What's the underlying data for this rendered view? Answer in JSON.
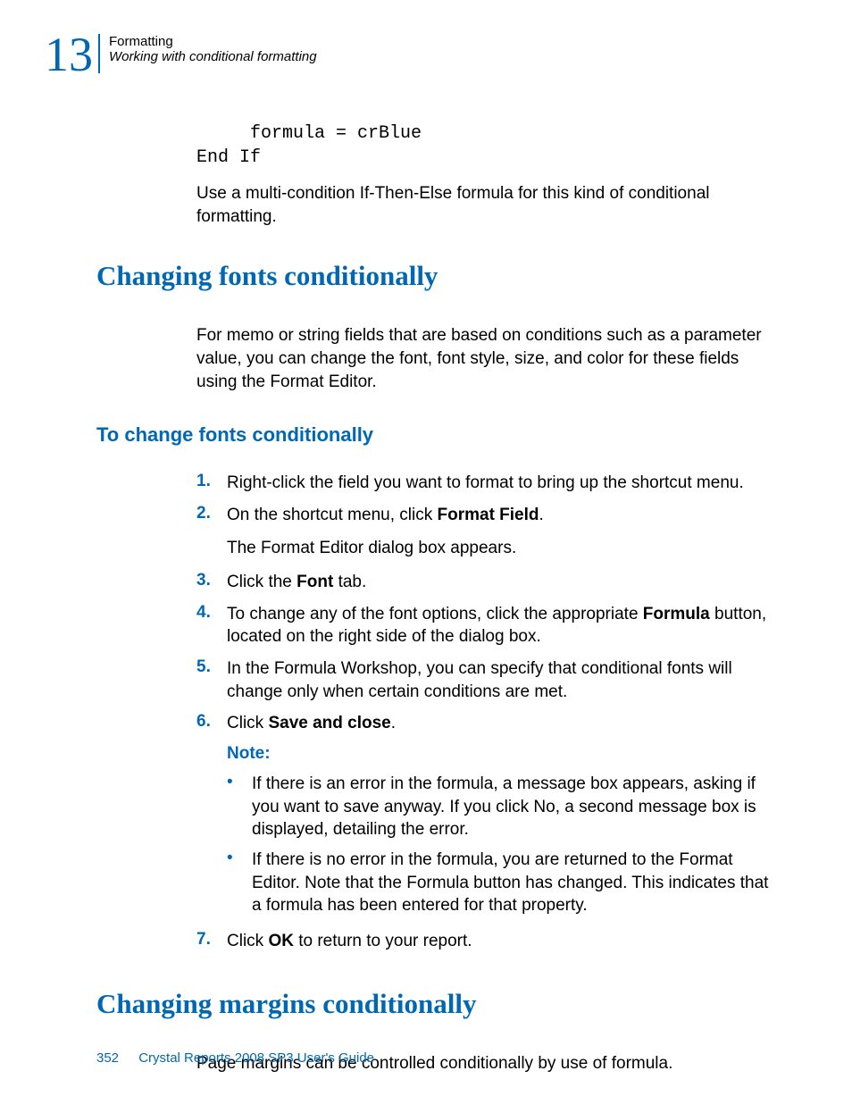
{
  "header": {
    "chapter_number": "13",
    "line1": "Formatting",
    "line2": "Working with conditional formatting"
  },
  "code": "     formula = crBlue\nEnd If",
  "para_after_code": "Use a multi-condition If-Then-Else formula for this kind of conditional formatting.",
  "section1": {
    "heading": "Changing fonts conditionally",
    "intro": "For memo or string fields that are based on conditions such as a parameter value, you can change the font, font style, size, and color for these fields using the Format Editor.",
    "subheading": "To change fonts conditionally",
    "steps": {
      "s1": {
        "num": "1.",
        "text": "Right-click the field you want to format to bring up the shortcut menu."
      },
      "s2": {
        "num": "2.",
        "pre": "On the shortcut menu, click ",
        "bold": "Format Field",
        "post": "."
      },
      "s2_sub": "The Format Editor dialog box appears.",
      "s3": {
        "num": "3.",
        "pre": "Click the ",
        "bold": "Font",
        "post": " tab."
      },
      "s4": {
        "num": "4.",
        "pre": "To change any of the font options, click the appropriate ",
        "bold": "Formula",
        "post": " button, located on the right side of the dialog box."
      },
      "s5": {
        "num": "5.",
        "text": "In the Formula Workshop, you can specify that conditional fonts will change only when certain conditions are met."
      },
      "s6": {
        "num": "6.",
        "pre": "Click ",
        "bold": "Save and close",
        "post": "."
      },
      "note_label": "Note:",
      "notes": {
        "n1": "If there is an error in the formula, a message box appears, asking if you want to save anyway. If you click No, a second message box is displayed, detailing the error.",
        "n2": "If there is no error in the formula, you are returned to the Format Editor. Note that the Formula button has changed. This indicates that a formula has been entered for that property."
      },
      "s7": {
        "num": "7.",
        "pre": "Click ",
        "bold": "OK",
        "post": " to return to your report."
      }
    }
  },
  "section2": {
    "heading": "Changing margins conditionally",
    "intro": "Page margins can be controlled conditionally by use of formula."
  },
  "footer": {
    "pagenum": "352",
    "title": "Crystal Reports 2008 SP3 User's Guide"
  }
}
